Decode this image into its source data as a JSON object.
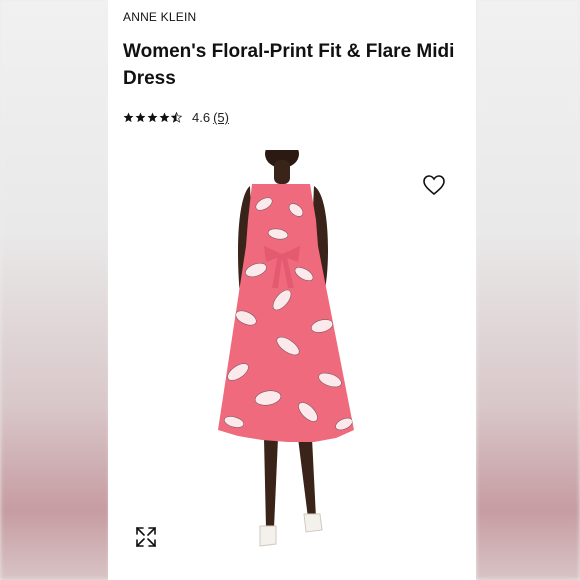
{
  "product": {
    "brand": "ANNE KLEIN",
    "title": "Women's Floral-Print Fit & Flare Midi Dress",
    "rating": {
      "value": "4.6",
      "count": "(5)",
      "stars": 4.5
    }
  },
  "icons": {
    "wishlist": "heart-outline-icon",
    "zoom": "expand-arrows-icon",
    "rating": "star-icon"
  },
  "colors": {
    "dress": "#f06a7e",
    "text": "#111111"
  }
}
